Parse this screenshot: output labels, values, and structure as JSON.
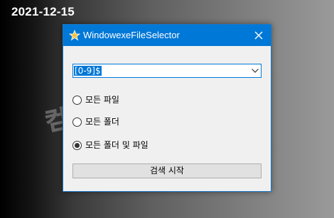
{
  "date": "2021-12-15",
  "watermark": "컴퓨터 관련 정보",
  "window": {
    "title": "WindowexeFileSelector",
    "icon": "star-icon",
    "close_icon": "close-icon",
    "pattern": {
      "value": "[0-9]$"
    },
    "options": [
      {
        "label": "모든 파일",
        "checked": false
      },
      {
        "label": "모든 폴더",
        "checked": false
      },
      {
        "label": "모든 폴더 및 파일",
        "checked": true
      }
    ],
    "search_button": "검색 시작"
  },
  "colors": {
    "titlebar": "#0078d7",
    "window_bg": "#f0f0f0",
    "selection": "#0078d7"
  }
}
